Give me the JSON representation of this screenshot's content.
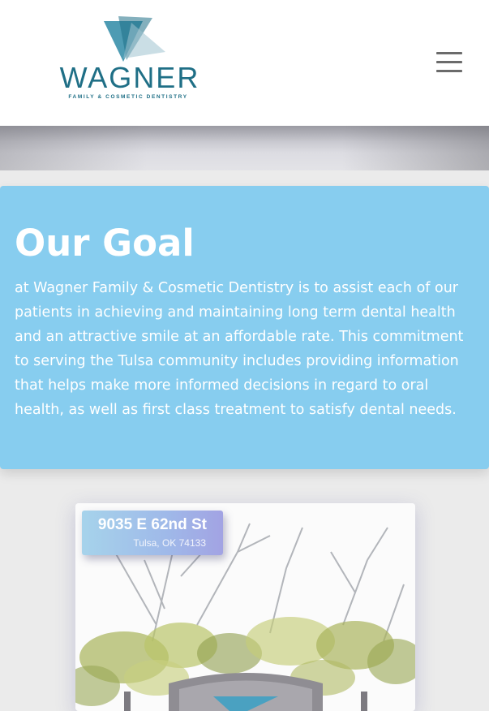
{
  "header": {
    "logo": {
      "name": "WAGNER",
      "tagline": "FAMILY & COSMETIC DENTISTRY"
    },
    "menu_icon": "hamburger-menu-icon"
  },
  "goal": {
    "title": "Our Goal",
    "text": "at Wagner Family & Cosmetic Dentistry is to assist each of our patients in achieving and maintaining long term dental health and an attractive smile at an affordable rate. This commitment to serving the Tulsa community includes providing information that helps make more informed decisions in regard to oral health, as well as first class treatment to satisfy dental needs."
  },
  "location": {
    "street": "9035 E 62nd St",
    "city": "Tulsa, OK 74133"
  },
  "colors": {
    "brand_teal": "#1f6f86",
    "goal_background": "#87cdef",
    "page_background": "#ebebeb"
  }
}
